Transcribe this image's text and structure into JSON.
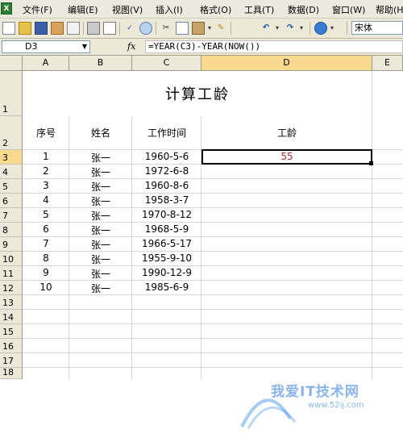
{
  "menu": {
    "items": [
      "文件(F)",
      "编辑(E)",
      "视图(V)",
      "插入(I)",
      "格式(O)",
      "工具(T)",
      "数据(D)",
      "窗口(W)",
      "帮助(H)"
    ]
  },
  "toolbar": {
    "font_name": "宋体"
  },
  "formula_bar": {
    "name_box": "D3",
    "fx_label": "fx",
    "formula": "=YEAR(C3)-YEAR(NOW())"
  },
  "columns": [
    "A",
    "B",
    "C",
    "D",
    "E"
  ],
  "rows": [
    "1",
    "2",
    "3",
    "4",
    "5",
    "6",
    "7",
    "8",
    "9",
    "10",
    "11",
    "12",
    "13",
    "14",
    "15",
    "16",
    "17",
    "18"
  ],
  "sheet": {
    "title": "计算工龄",
    "headers": {
      "seq": "序号",
      "name": "姓名",
      "work_date": "工作时间",
      "seniority": "工龄"
    },
    "records": [
      {
        "seq": "1",
        "name": "张一",
        "date": "1960-5-6"
      },
      {
        "seq": "2",
        "name": "张一",
        "date": "1972-6-8"
      },
      {
        "seq": "3",
        "name": "张一",
        "date": "1960-8-6"
      },
      {
        "seq": "4",
        "name": "张一",
        "date": "1958-3-7"
      },
      {
        "seq": "5",
        "name": "张一",
        "date": "1970-8-12"
      },
      {
        "seq": "6",
        "name": "张一",
        "date": "1968-5-9"
      },
      {
        "seq": "7",
        "name": "张一",
        "date": "1966-5-17"
      },
      {
        "seq": "8",
        "name": "张一",
        "date": "1955-9-10"
      },
      {
        "seq": "9",
        "name": "张一",
        "date": "1990-12-9"
      },
      {
        "seq": "10",
        "name": "张一",
        "date": "1985-6-9"
      }
    ],
    "result_d3": "55"
  },
  "watermark": {
    "text": "我爱IT技术网",
    "url": "www.52ij.com"
  }
}
